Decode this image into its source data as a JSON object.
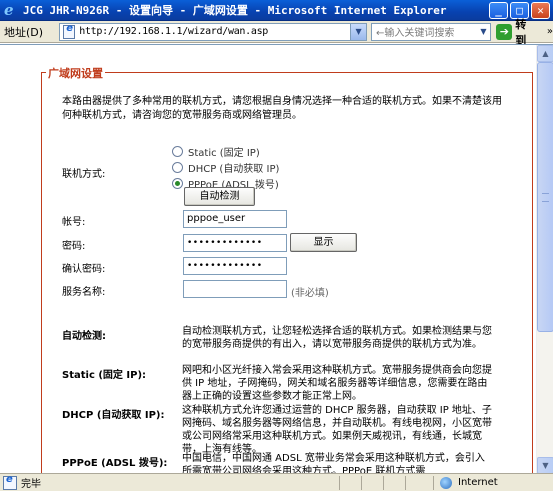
{
  "window": {
    "title": "JCG JHR-N926R - 设置向导 - 广域网设置 - Microsoft Internet Explorer",
    "min_symbol": "_",
    "max_symbol": "□",
    "close_symbol": "✕"
  },
  "address_bar": {
    "label": "地址(D)",
    "url": "http://192.168.1.1/wizard/wan.asp",
    "dropdown_symbol": "▼",
    "search_placeholder": "←输入关键词搜索",
    "go_label": "转到",
    "go_arrow": "➔",
    "links_symbol": "»"
  },
  "wan": {
    "legend": "广域网设置",
    "intro": "本路由器提供了多种常用的联机方式，请您根据自身情况选择一种合适的联机方式。如果不清楚该用何种联机方式，请咨询您的宽带服务商或网络管理员。",
    "connection_label": "联机方式:",
    "options": [
      {
        "label": "Static (固定 IP)",
        "checked": false
      },
      {
        "label": "DHCP (自动获取 IP)",
        "checked": false
      },
      {
        "label": "PPPoE (ADSL 拨号)",
        "checked": true
      }
    ],
    "autodetect_button": "自动检测",
    "account_label": "帐号:",
    "account_value": "pppoe_user",
    "password_label": "密码:",
    "password_value": "•••••••••••••",
    "show_button": "显示",
    "confirm_label": "确认密码:",
    "confirm_value": "•••••••••••••",
    "service_label": "服务名称:",
    "service_value": "",
    "service_note": "(非必填)"
  },
  "help": [
    {
      "term": "自动检测:",
      "desc": "自动检测联机方式，让您轻松选择合适的联机方式。如果检测结果与您的宽带服务商提供的有出入，请以宽带服务商提供的联机方式为准。"
    },
    {
      "term": "Static (固定 IP):",
      "desc": "网吧和小区光纤接入常会采用这种联机方式。宽带服务提供商会向您提供 IP 地址，子网掩码，网关和域名服务器等详细信息，您需要在路由器上正确的设置这些参数才能正常上网。"
    },
    {
      "term": "DHCP (自动获取 IP):",
      "desc": "这种联机方式允许您通过运营的 DHCP 服务器，自动获取 IP 地址、子网掩码、域名服务器等网络信息，并自动联机。有线电视网，小区宽带或公司网络常采用这种联机方式。如果例天威视讯，有线通，长城宽带，上海有线等。"
    },
    {
      "term": "PPPoE (ADSL 拨号):",
      "desc": "中国电信，中国网通 ADSL 宽带业务常会采用这种联机方式，会引入所需宽带公司网络会采用这种方式。PPPoE 联机方式需"
    }
  ],
  "status": {
    "text": "完毕",
    "zone": "Internet"
  }
}
